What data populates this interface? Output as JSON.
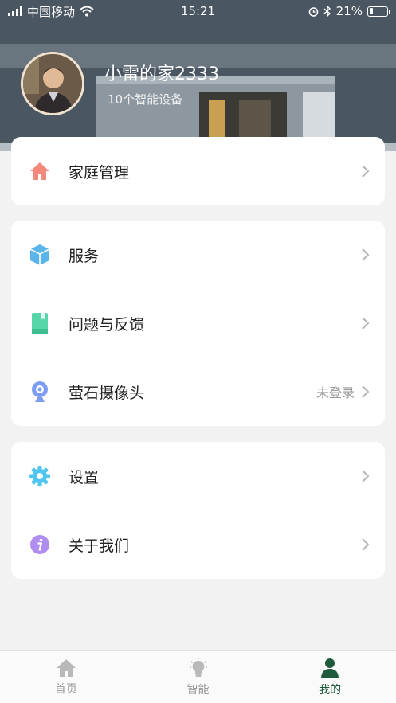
{
  "status_bar": {
    "carrier": "中国移动",
    "time": "15:21",
    "battery": "21%",
    "battery_level": 0.21
  },
  "profile": {
    "home_name": "小雷的家2333",
    "device_count": "10个智能设备"
  },
  "menu": {
    "family": {
      "label": "家庭管理",
      "icon": "house-icon",
      "color": "#f2897a"
    },
    "service": {
      "label": "服务",
      "icon": "cube-icon",
      "color": "#5bb5ea"
    },
    "feedback": {
      "label": "问题与反馈",
      "icon": "book-icon",
      "color": "#56d6a8"
    },
    "camera": {
      "label": "萤石摄像头",
      "note": "未登录",
      "icon": "webcam-icon",
      "color": "#7c9df3"
    },
    "settings": {
      "label": "设置",
      "icon": "gear-icon",
      "color": "#4fc6f0"
    },
    "about": {
      "label": "关于我们",
      "icon": "info-icon",
      "color": "#b08df0"
    }
  },
  "tabs": [
    {
      "label": "首页",
      "icon": "home-icon",
      "active": false
    },
    {
      "label": "智能",
      "icon": "lightbulb-icon",
      "active": false
    },
    {
      "label": "我的",
      "icon": "user-icon",
      "active": true
    }
  ],
  "colors": {
    "accent": "#1f5a3c",
    "background": "#f2f2f2",
    "chevron": "#b5b5b5"
  }
}
